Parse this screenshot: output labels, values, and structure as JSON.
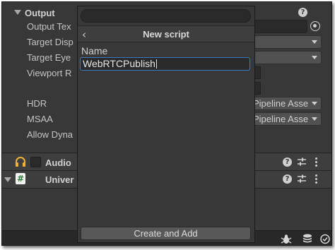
{
  "section": {
    "title": "Output",
    "help_icon": "?"
  },
  "properties": [
    {
      "label": "Output Tex"
    },
    {
      "label": "Target Disp"
    },
    {
      "label": "Target Eye"
    },
    {
      "label": "Viewport R"
    },
    {
      "label": "HDR",
      "value": "Pipeline Asse"
    },
    {
      "label": "MSAA",
      "value": "Pipeline Asse"
    },
    {
      "label": "Allow Dyna"
    }
  ],
  "components": [
    {
      "title": "Audio",
      "icon": "headphones-icon"
    },
    {
      "title": "Univer",
      "icon": "script-hash-icon",
      "icon_glyph": "#"
    }
  ],
  "popup": {
    "search_placeholder": "",
    "title": "New script",
    "back_glyph": "‹",
    "name_label": "Name",
    "name_value": "WebRTCPublish",
    "create_button": "Create and Add"
  },
  "colors": {
    "background": "#383838",
    "accent_focus": "#3a79bb",
    "button": "#585858",
    "audio_icon": "#f0b23a",
    "script_icon": "#2f7f3a"
  },
  "statusbar": {
    "icons": [
      "bug-icon",
      "layers-icon",
      "check-circle-icon"
    ]
  }
}
